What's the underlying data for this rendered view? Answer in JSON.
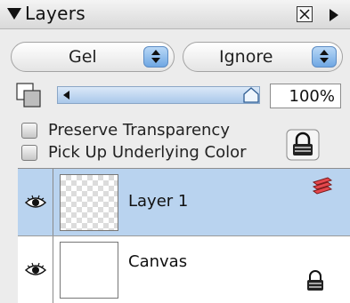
{
  "panel": {
    "title": "Layers"
  },
  "blend": {
    "mode_value": "Gel",
    "composite_value": "Ignore"
  },
  "opacity": {
    "value_label": "100%",
    "level": 1.0
  },
  "options": {
    "preserve_transparency": "Preserve Transparency",
    "pick_up_underlying": "Pick Up Underlying Color"
  },
  "layers": [
    {
      "name": "Layer 1",
      "selected": true,
      "visible": true,
      "thumbnail": "transparent"
    },
    {
      "name": "Canvas",
      "selected": false,
      "visible": true,
      "thumbnail": "white"
    }
  ],
  "colors": {
    "selection": "#b9d3ef",
    "accent": "#6fa7e3",
    "layer_stack_icon": "#e5484d"
  },
  "icons": [
    "disclosure-triangle-icon",
    "close-box-icon",
    "panel-menu-arrow-icon",
    "stepper-icon",
    "swatch-icon",
    "eye-icon",
    "lock-icon",
    "layer-stack-icon"
  ]
}
